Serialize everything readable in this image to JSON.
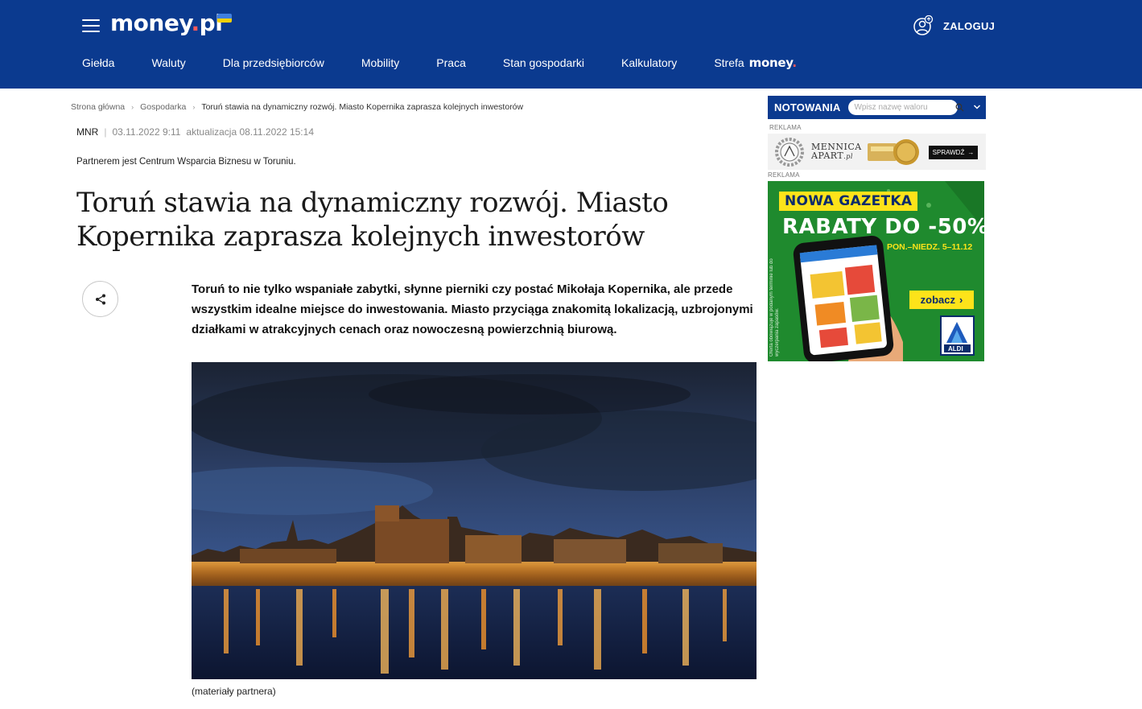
{
  "header": {
    "logo": "money.pl",
    "login_label": "ZALOGUJ",
    "nav": [
      "Giełda",
      "Waluty",
      "Dla przedsiębiorców",
      "Mobility",
      "Praca",
      "Stan gospodarki",
      "Kalkulatory"
    ],
    "strefa_label": "Strefa",
    "strefa_brand": "money."
  },
  "breadcrumb": {
    "home": "Strona główna",
    "section": "Gospodarka",
    "current": "Toruń stawia na dynamiczny rozwój. Miasto Kopernika zaprasza kolejnych inwestorów"
  },
  "article": {
    "author": "MNR",
    "published": "03.11.2022 9:11",
    "updated": "aktualizacja 08.11.2022 15:14",
    "partner_note": "Partnerem jest Centrum Wsparcia Biznesu w Toruniu.",
    "title": "Toruń stawia na dynamiczny rozwój. Miasto Kopernika zaprasza kolejnych inwestorów",
    "lead": "Toruń to nie tylko wspaniałe zabytki, słynne pierniki czy postać Mikołaja Kopernika, ale przede wszystkim idealne miejsce do inwestowania. Miasto przyciąga znakomitą lokalizacją, uzbrojonymi działkami w atrakcyjnych cenach oraz nowoczesną powierzchnią biurową.",
    "image_caption": "(materiały partnera)"
  },
  "sidebar": {
    "quotes_label": "NOTOWANIA",
    "quotes_placeholder": "Wpisz nazwę waloru",
    "ad_label": "REKLAMA",
    "ad1": {
      "brand_line1": "MENNICA",
      "brand_line2": "APART",
      "brand_suffix": ".pl",
      "cta": "SPRAWDŹ"
    },
    "ad2": {
      "badge": "NOWA GAZETKA",
      "headline": "RABATY DO -50%",
      "dates": "PON.–NIEDZ. 5–11.12",
      "cta": "zobacz",
      "brand": "ALDI",
      "fineprint": "Oferta obowiązuje w podanym terminie lub do wyczerpania zapasów."
    }
  },
  "colors": {
    "header_bg": "#0b3a8f",
    "logo_dot": "#ff5a5a",
    "ad_green": "#1f8a2e",
    "ad_yellow": "#fde31a"
  }
}
